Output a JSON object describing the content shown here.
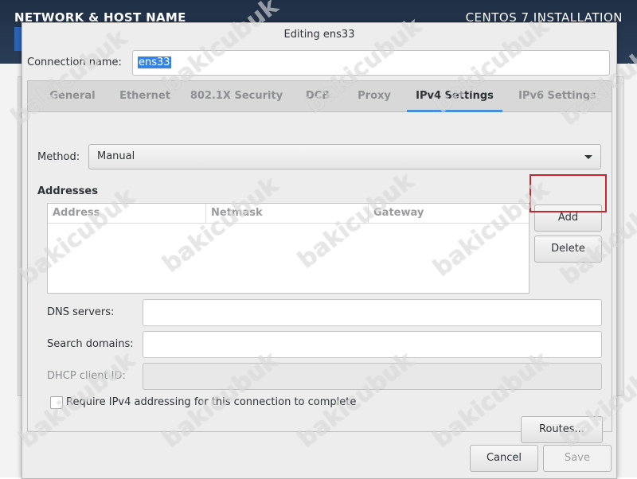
{
  "background": {
    "left_title": "NETWORK & HOST NAME",
    "right_title": "CENTOS 7 INSTALLATION"
  },
  "dialog": {
    "title": "Editing ens33",
    "connection_name_label": "Connection name:",
    "connection_name_value": "ens33",
    "tabs": [
      {
        "label": "General",
        "active": false
      },
      {
        "label": "Ethernet",
        "active": false
      },
      {
        "label": "802.1X Security",
        "active": false
      },
      {
        "label": "DCB",
        "active": false
      },
      {
        "label": "Proxy",
        "active": false
      },
      {
        "label": "IPv4 Settings",
        "active": true
      },
      {
        "label": "IPv6 Settings",
        "active": false
      }
    ],
    "ipv4": {
      "method_label": "Method:",
      "method_value": "Manual",
      "addresses_title": "Addresses",
      "columns": [
        "Address",
        "Netmask",
        "Gateway"
      ],
      "add_button": "Add",
      "delete_button": "Delete",
      "dns_label": "DNS servers:",
      "dns_value": "",
      "search_label": "Search domains:",
      "search_value": "",
      "dhcp_label": "DHCP client ID:",
      "dhcp_value": "",
      "require_label": "Require IPv4 addressing for this connection to complete",
      "require_checked": false,
      "routes_button": "Routes..."
    },
    "cancel_button": "Cancel",
    "save_button": "Save"
  },
  "watermark": "bakicubuk",
  "colors": {
    "accent": "#4a90d9",
    "highlight": "#c1272d",
    "header": "#1f2f45"
  }
}
